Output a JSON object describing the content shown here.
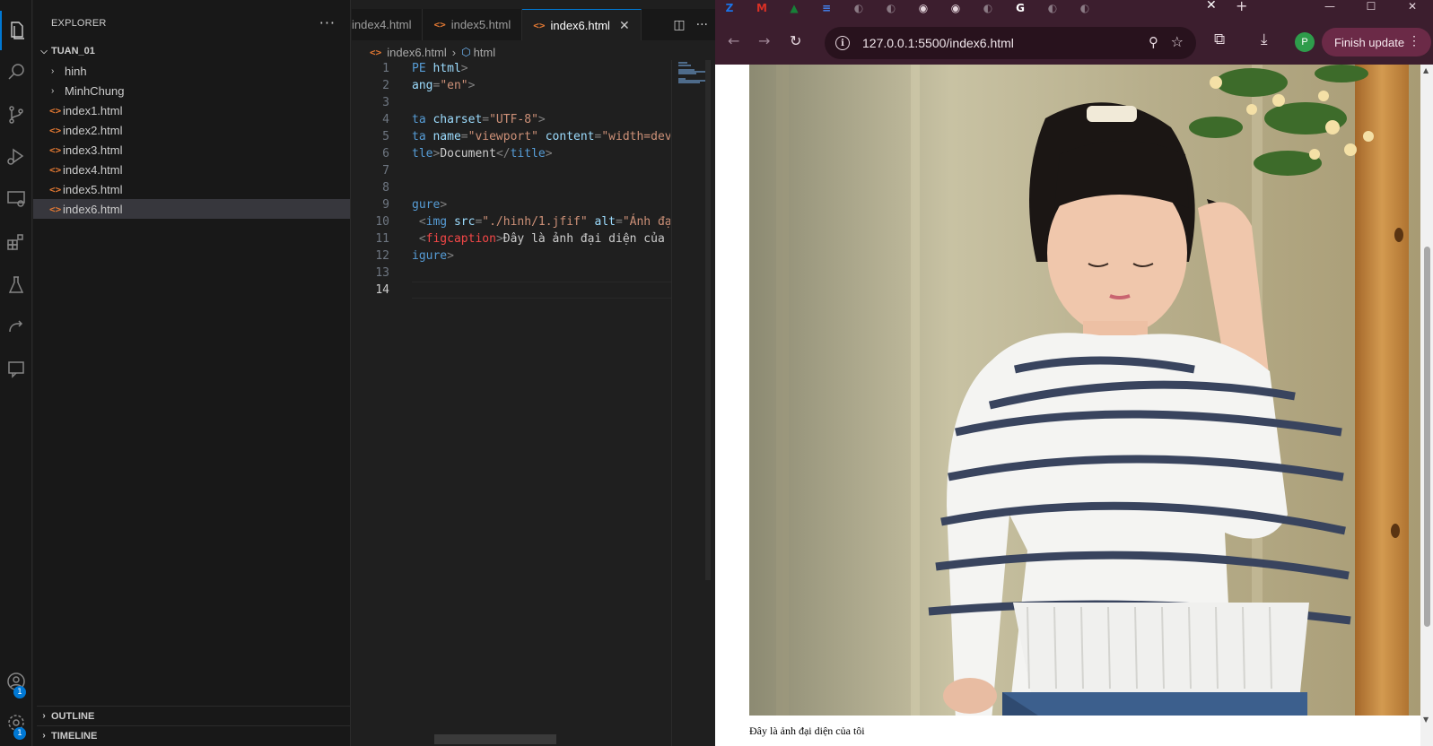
{
  "vscode": {
    "explorer_title": "EXPLORER",
    "more_label": "···",
    "folder_name": "TUAN_01",
    "tree": [
      {
        "type": "folder",
        "label": "hinh"
      },
      {
        "type": "folder",
        "label": "MinhChung"
      },
      {
        "type": "file",
        "label": "index1.html"
      },
      {
        "type": "file",
        "label": "index2.html"
      },
      {
        "type": "file",
        "label": "index3.html"
      },
      {
        "type": "file",
        "label": "index4.html"
      },
      {
        "type": "file",
        "label": "index5.html"
      },
      {
        "type": "file",
        "label": "index6.html",
        "selected": true
      }
    ],
    "outline_label": "OUTLINE",
    "timeline_label": "TIMELINE",
    "accounts_badge": "1",
    "settings_badge": "1",
    "tabs": [
      {
        "label": "index4.html",
        "active": false
      },
      {
        "label": "index5.html",
        "active": false
      },
      {
        "label": "index6.html",
        "active": true
      }
    ],
    "breadcrumb": {
      "file": "index6.html",
      "symbol": "html"
    },
    "current_line": 14,
    "code_lines": [
      {
        "n": "1",
        "tokens": [
          [
            "tag",
            "PE "
          ],
          [
            "attr",
            "html"
          ],
          [
            "pun",
            ">"
          ]
        ]
      },
      {
        "n": "2",
        "tokens": [
          [
            "attr",
            "ang"
          ],
          [
            "pun",
            "="
          ],
          [
            "str",
            "\"en\""
          ],
          [
            "pun",
            ">"
          ]
        ]
      },
      {
        "n": "3",
        "tokens": []
      },
      {
        "n": "4",
        "tokens": [
          [
            "tag",
            "ta "
          ],
          [
            "attr",
            "charset"
          ],
          [
            "pun",
            "="
          ],
          [
            "str",
            "\"UTF-8\""
          ],
          [
            "pun",
            ">"
          ]
        ]
      },
      {
        "n": "5",
        "tokens": [
          [
            "tag",
            "ta "
          ],
          [
            "attr",
            "name"
          ],
          [
            "pun",
            "="
          ],
          [
            "str",
            "\"viewport\" "
          ],
          [
            "attr",
            "content"
          ],
          [
            "pun",
            "="
          ],
          [
            "str",
            "\"width=dev"
          ]
        ]
      },
      {
        "n": "6",
        "tokens": [
          [
            "tag",
            "tle"
          ],
          [
            "pun",
            ">"
          ],
          [
            "txt",
            "Document"
          ],
          [
            "pun",
            "</"
          ],
          [
            "tag",
            "title"
          ],
          [
            "pun",
            ">"
          ]
        ]
      },
      {
        "n": "7",
        "tokens": []
      },
      {
        "n": "8",
        "tokens": []
      },
      {
        "n": "9",
        "tokens": [
          [
            "tag",
            "gure"
          ],
          [
            "pun",
            ">"
          ]
        ]
      },
      {
        "n": "10",
        "tokens": [
          [
            "pun",
            " <"
          ],
          [
            "tag",
            "img "
          ],
          [
            "attr",
            "src"
          ],
          [
            "pun",
            "="
          ],
          [
            "str",
            "\"./hinh/1.jfif\" "
          ],
          [
            "attr",
            "alt"
          ],
          [
            "pun",
            "="
          ],
          [
            "str",
            "\"Ảnh đạ"
          ]
        ]
      },
      {
        "n": "11",
        "tokens": [
          [
            "pun",
            " <"
          ],
          [
            "red",
            "figcaption"
          ],
          [
            "pun",
            ">"
          ],
          [
            "txt",
            "Đây là ảnh đại diện của "
          ]
        ]
      },
      {
        "n": "12",
        "tokens": [
          [
            "tag",
            "igure"
          ],
          [
            "pun",
            ">"
          ]
        ]
      },
      {
        "n": "13",
        "tokens": []
      },
      {
        "n": "14",
        "tokens": []
      }
    ]
  },
  "browser": {
    "url": "127.0.0.1:5500/index6.html",
    "finish_update_label": "Finish update",
    "profile_initial": "P",
    "tab_favicons": [
      "zalo-icon",
      "gmail-icon",
      "drive-icon",
      "docs-icon",
      "globe-icon",
      "globe-icon",
      "github-icon",
      "github-icon",
      "globe-icon",
      "google-icon",
      "globe-icon",
      "globe-icon"
    ],
    "caption": "Đây là ảnh đại diện của tôi",
    "photo_alt": "Ảnh đại diện",
    "scroll_fraction": 0.52
  },
  "colors": {
    "vscode_accent": "#0078d4",
    "html_file_icon": "#e37933",
    "browser_frame": "#3c1e2e",
    "finish_update_bg": "#6b2a47"
  }
}
